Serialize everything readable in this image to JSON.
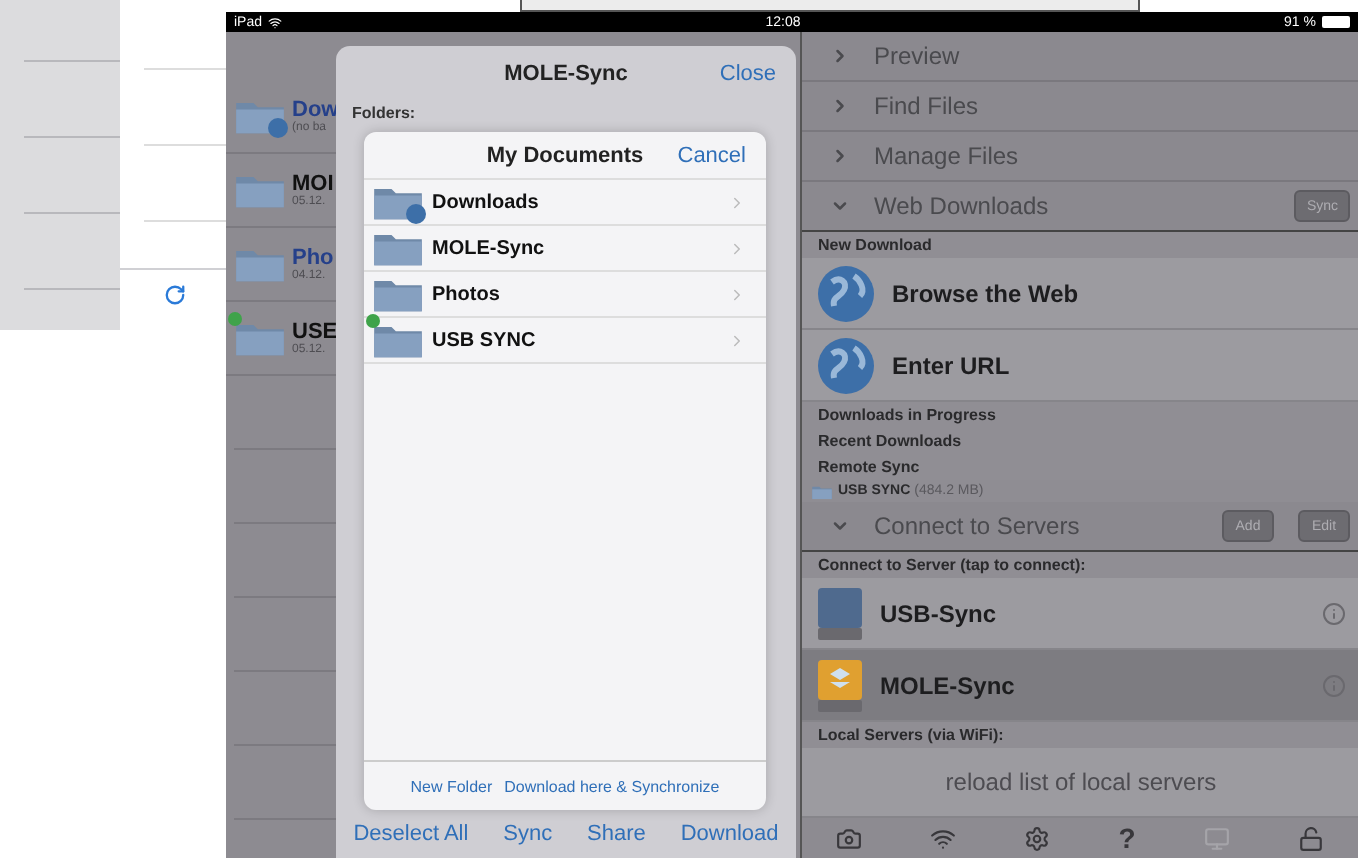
{
  "status_bar": {
    "device": "iPad",
    "time": "12:08",
    "battery": "91 %"
  },
  "file_list": [
    {
      "name": "Dow",
      "detail": "(no ba",
      "kind": "web"
    },
    {
      "name": "MOI",
      "detail": "05.12.",
      "kind": "folder"
    },
    {
      "name": "Pho",
      "detail": "04.12.",
      "kind": "photos"
    },
    {
      "name": "USE",
      "detail": "05.12.",
      "kind": "usb"
    }
  ],
  "sync_popover": {
    "title": "MOLE-Sync",
    "close": "Close",
    "section": "Folders:",
    "actions": [
      "Deselect All",
      "Sync",
      "Share",
      "Download"
    ]
  },
  "picker": {
    "title": "My Documents",
    "cancel": "Cancel",
    "folders": [
      {
        "name": "Downloads",
        "kind": "web"
      },
      {
        "name": "MOLE-Sync",
        "kind": "folder"
      },
      {
        "name": "Photos",
        "kind": "folder"
      },
      {
        "name": "USB SYNC",
        "kind": "usb"
      }
    ],
    "actions": [
      "New Folder",
      "Download here & Synchronize"
    ]
  },
  "sidebar": {
    "sections": [
      {
        "label": "Preview",
        "expanded": false
      },
      {
        "label": "Find Files",
        "expanded": false
      },
      {
        "label": "Manage Files",
        "expanded": false
      },
      {
        "label": "Web Downloads",
        "expanded": true,
        "buttons": [
          "Sync"
        ],
        "groups": [
          {
            "header": "New Download",
            "items": [
              {
                "label": "Browse the Web",
                "kind": "globe"
              },
              {
                "label": "Enter URL",
                "kind": "globe"
              }
            ]
          },
          {
            "header": "Downloads in Progress"
          },
          {
            "header": "Recent Downloads"
          },
          {
            "header": "Remote Sync",
            "items": [
              {
                "label": "USB SYNC",
                "note": "(484.2 MB)",
                "kind": "small-folder"
              }
            ]
          }
        ]
      },
      {
        "label": "Connect to Servers",
        "expanded": true,
        "buttons": [
          "Add",
          "Edit"
        ],
        "groups": [
          {
            "header": "Connect to Server (tap to connect):",
            "items": [
              {
                "label": "USB-Sync",
                "kind": "drive",
                "selected": false
              },
              {
                "label": "MOLE-Sync",
                "kind": "cloud-drive",
                "selected": true
              }
            ]
          },
          {
            "header": "Local Servers (via WiFi):",
            "items": [
              {
                "label": "reload list of local servers",
                "kind": "action"
              }
            ]
          }
        ]
      }
    ]
  },
  "toolbar": {
    "help": "?"
  }
}
